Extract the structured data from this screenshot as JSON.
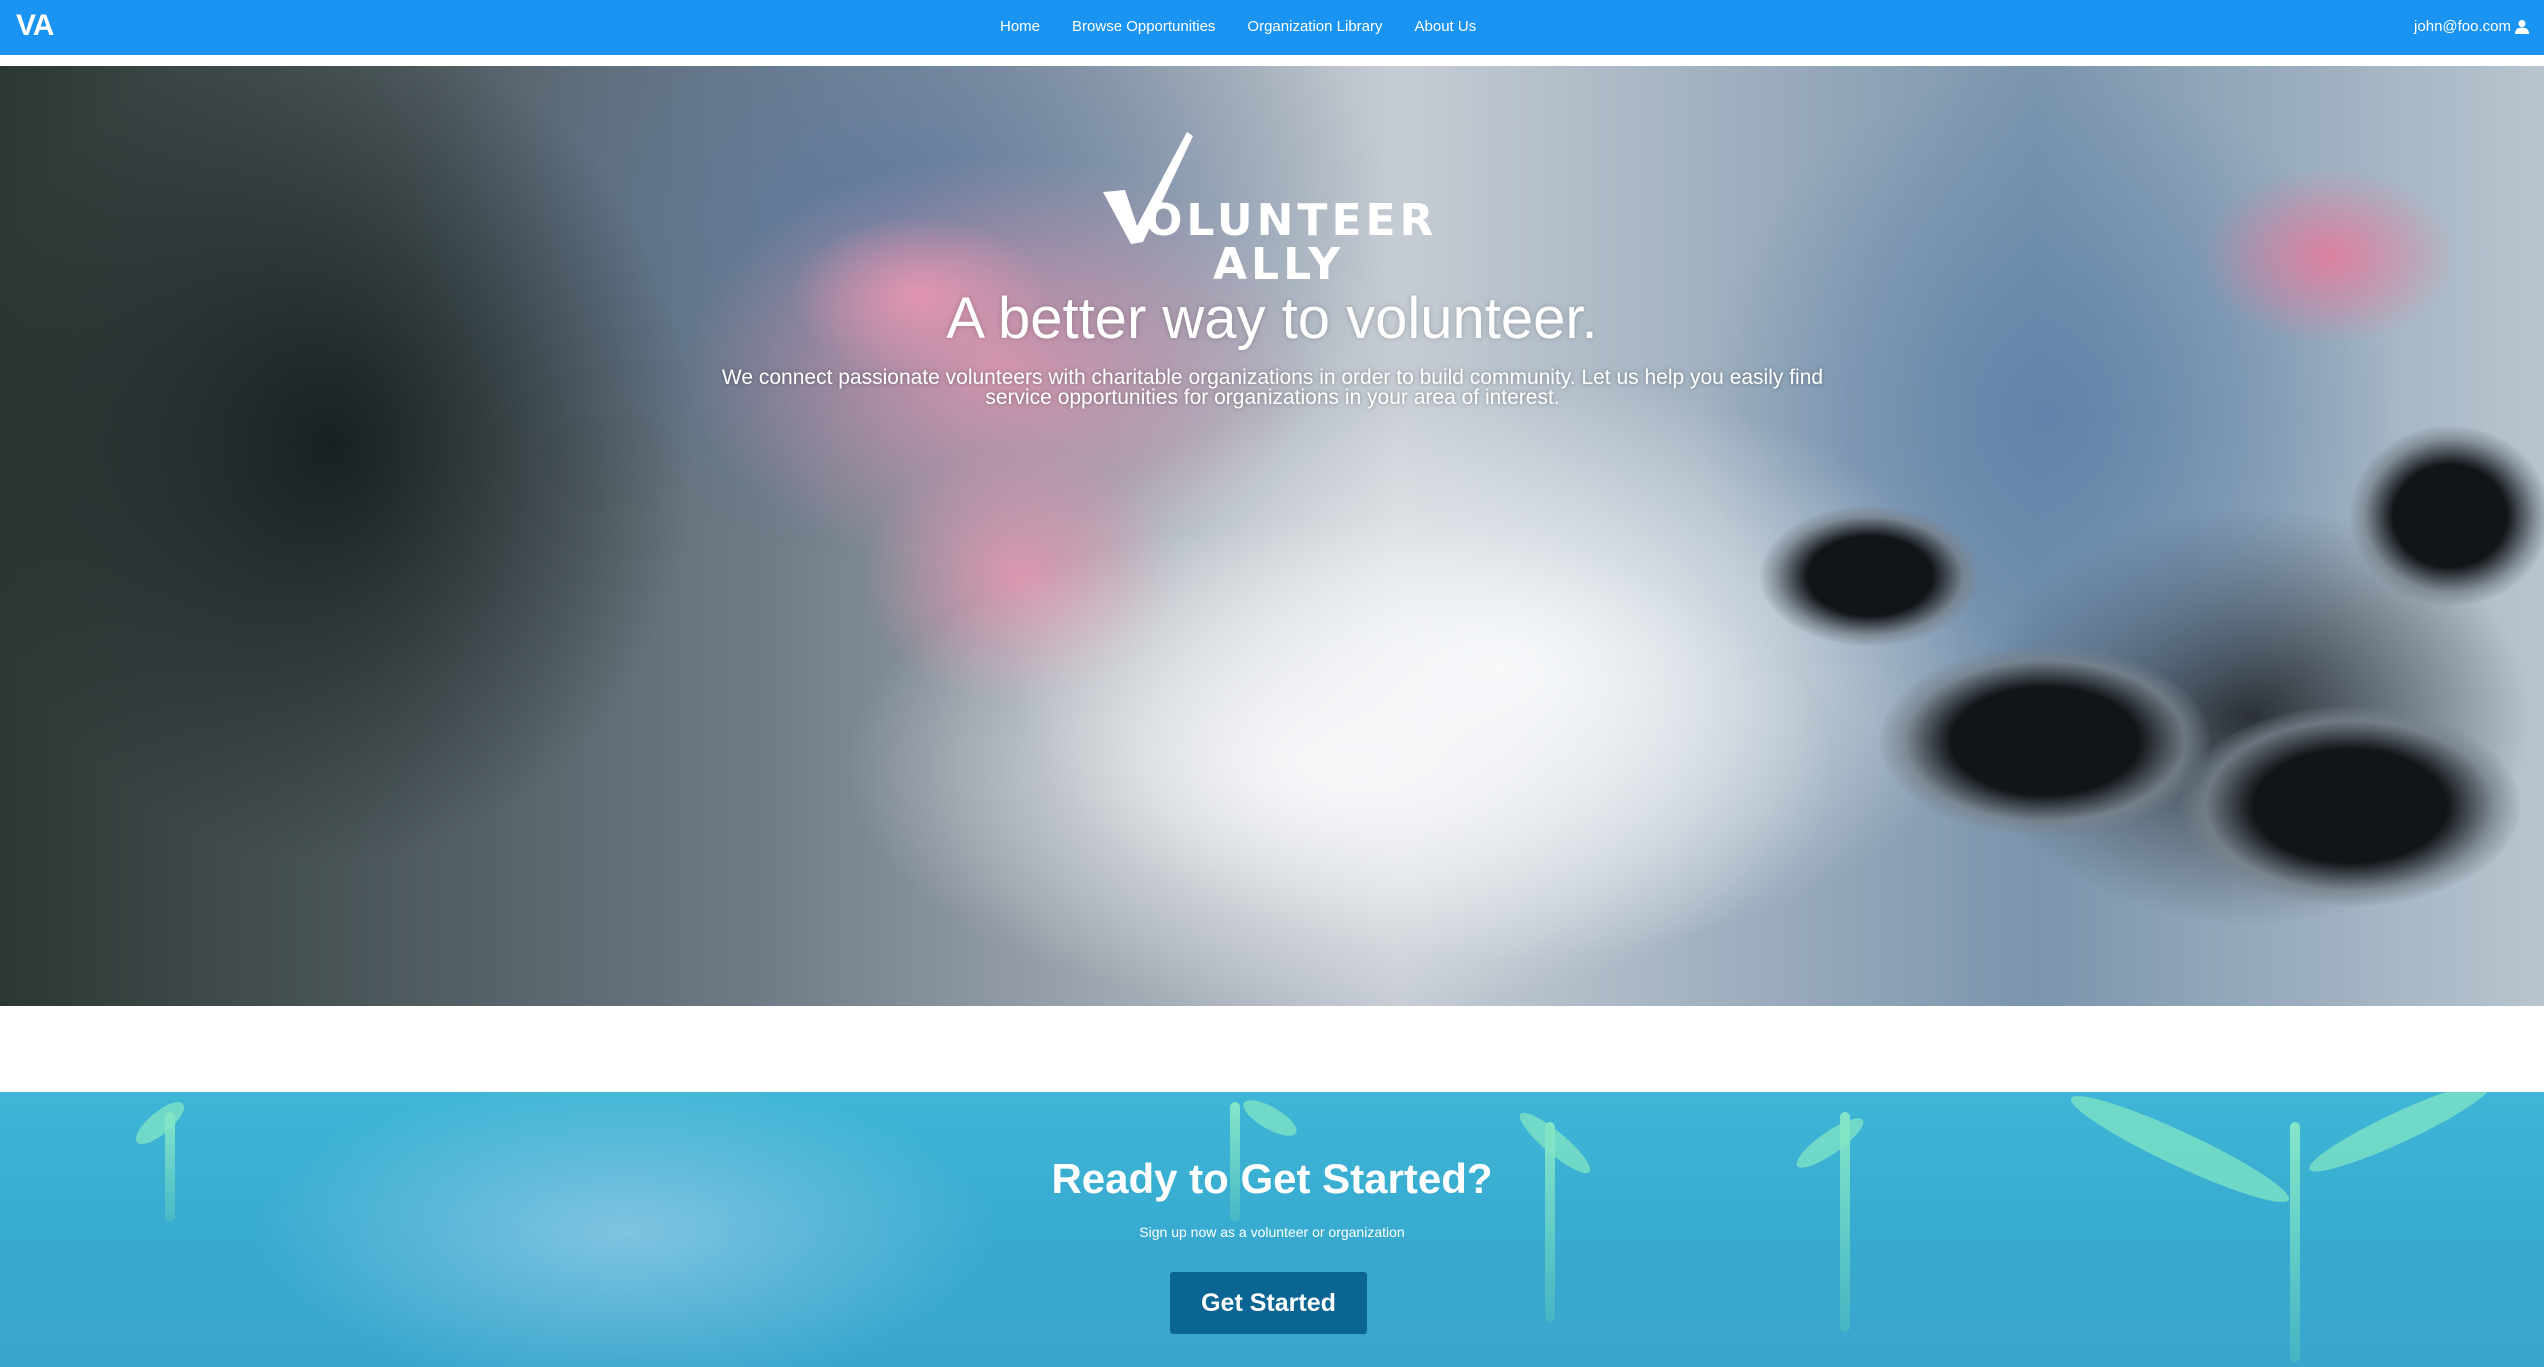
{
  "navbar": {
    "brand": "VA",
    "links": [
      "Home",
      "Browse Opportunities",
      "Organization Library",
      "About Us"
    ],
    "user_email": "john@foo.com",
    "user_icon": "user-icon",
    "color": "#1a94f2"
  },
  "hero": {
    "logo": {
      "line1": "OLUNTEER",
      "line2": "ALLY"
    },
    "title": "A better way to volunteer.",
    "subtitle": "We connect passionate volunteers with charitable organizations in order to build community. Let us help you easily find service opportunities for organizations in your area of interest."
  },
  "cta": {
    "title": "Ready to Get Started?",
    "subtitle": "Sign up now as a volunteer or organization",
    "button_label": "Get Started",
    "button_color": "#0a6592"
  }
}
